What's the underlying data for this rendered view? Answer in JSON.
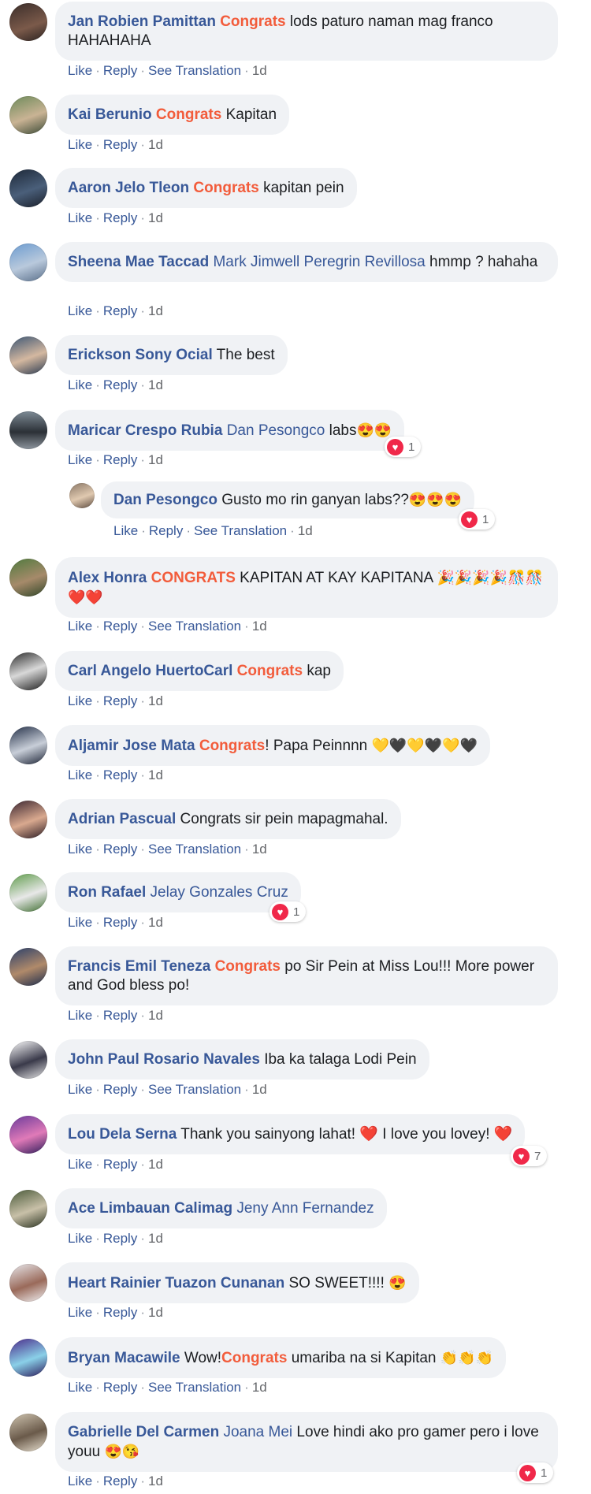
{
  "actions": {
    "like": "Like",
    "reply": "Reply",
    "see_translation": "See Translation"
  },
  "comments": [
    {
      "author": "Jan Robien Pamittan",
      "hl": "Congrats",
      "text": " lods paturo naman mag franco HAHAHAHA",
      "time": "1d",
      "translate": true
    },
    {
      "author": "Kai Berunio",
      "hl": "Congrats",
      "text": " Kapitan",
      "time": "1d"
    },
    {
      "author": "Aaron Jelo Tleon",
      "hl": "Congrats",
      "text": " kapitan pein",
      "time": "1d"
    },
    {
      "author": "Sheena Mae Taccad",
      "mention": "Mark Jimwell Peregrin Revillosa",
      "text": " hmmp ? hahaha",
      "time": "1d"
    },
    {
      "author": "Erickson Sony Ocial",
      "text": " The best",
      "time": "1d"
    },
    {
      "author": "Maricar Crespo Rubia",
      "mention": "Dan Pesongco",
      "text": " labs",
      "emoji": "😍😍",
      "time": "1d",
      "reactions": "1"
    },
    {
      "author": "Dan Pesongco",
      "text": " Gusto mo rin ganyan labs??",
      "emoji": "😍😍😍",
      "time": "1d",
      "translate": true,
      "reactions": "1"
    },
    {
      "author": "Alex Honra",
      "hl": "CONGRATS",
      "text": " KAPITAN AT KAY KAPITANA ",
      "emoji": "🎉🎉🎉🎉🎊🎊❤️❤️",
      "time": "1d",
      "translate": true
    },
    {
      "author": "Carl Angelo HuertoCarl",
      "hl": "Congrats",
      "text": " kap",
      "time": "1d"
    },
    {
      "author": "Aljamir Jose Mata",
      "hl": "Congrats",
      "text": "! Papa Peinnnn ",
      "emoji": "💛🖤💛🖤💛🖤",
      "time": "1d"
    },
    {
      "author": "Adrian Pascual",
      "text": " Congrats sir pein mapagmahal.",
      "time": "1d",
      "translate": true
    },
    {
      "author": "Ron Rafael",
      "mention": "Jelay Gonzales Cruz",
      "time": "1d",
      "reactions": "1"
    },
    {
      "author": "Francis Emil Teneza",
      "hl": "Congrats",
      "text": " po Sir Pein at Miss Lou!!! More power and God bless po!",
      "time": "1d"
    },
    {
      "author": "John Paul Rosario Navales",
      "text": " Iba ka talaga Lodi Pein",
      "time": "1d",
      "translate": true
    },
    {
      "author": "Lou Dela Serna",
      "text": " Thank you sainyong lahat! ❤️ I love you lovey! ❤️",
      "time": "1d",
      "reactions": "7"
    },
    {
      "author": "Ace Limbauan Calimag",
      "mention": "Jeny Ann Fernandez",
      "time": "1d"
    },
    {
      "author": "Heart Rainier Tuazon Cunanan",
      "text": " SO SWEET!!!! ",
      "emoji": "😍",
      "time": "1d"
    },
    {
      "author": "Bryan Macawile",
      "text": " Wow!",
      "hl2": "Congrats",
      "text2": " umariba na si Kapitan ",
      "emoji": "👏👏👏",
      "time": "1d",
      "translate": true
    },
    {
      "author": "Gabrielle Del Carmen",
      "mention": "Joana Mei",
      "text": " Love hindi ako pro gamer pero i love youu ",
      "emoji": "😍😘",
      "time": "1d",
      "reactions": "1"
    }
  ],
  "colors": {
    "link": "#385898",
    "highlight": "#f25c3b",
    "bubble": "#f0f2f5",
    "heart": "#f02849"
  }
}
